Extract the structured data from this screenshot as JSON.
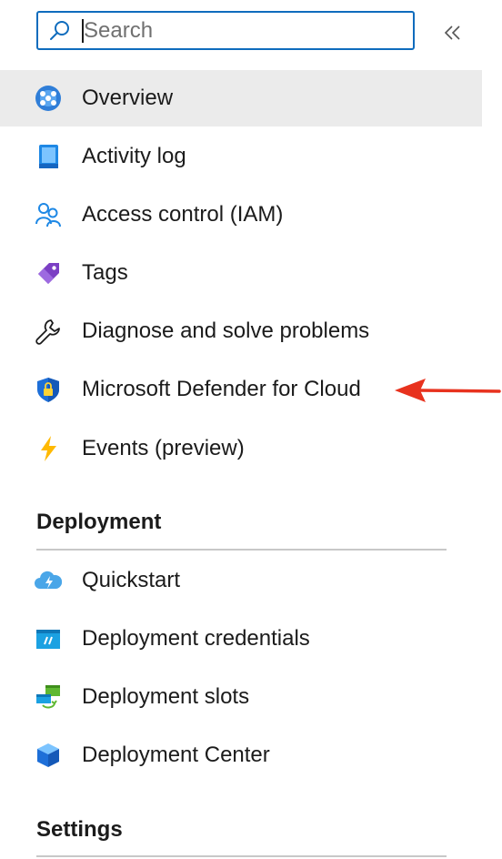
{
  "search": {
    "placeholder": "Search",
    "icon": "search-icon"
  },
  "collapse_icon": "double-chevron-left-icon",
  "nav_items": [
    {
      "label": "Overview",
      "icon": "overview-icon",
      "selected": true
    },
    {
      "label": "Activity log",
      "icon": "activity-log-icon"
    },
    {
      "label": "Access control (IAM)",
      "icon": "people-icon"
    },
    {
      "label": "Tags",
      "icon": "tag-icon"
    },
    {
      "label": "Diagnose and solve problems",
      "icon": "wrench-icon"
    },
    {
      "label": "Microsoft Defender for Cloud",
      "icon": "shield-lock-icon"
    },
    {
      "label": "Events (preview)",
      "icon": "lightning-icon"
    }
  ],
  "sections": [
    {
      "title": "Deployment",
      "items": [
        {
          "label": "Quickstart",
          "icon": "cloud-lightning-icon"
        },
        {
          "label": "Deployment credentials",
          "icon": "credentials-icon"
        },
        {
          "label": "Deployment slots",
          "icon": "deployment-slots-icon"
        },
        {
          "label": "Deployment Center",
          "icon": "cube-icon"
        }
      ]
    },
    {
      "title": "Settings",
      "items": []
    }
  ],
  "colors": {
    "accent": "#0f6cbd",
    "selected_background": "#ebebeb",
    "annotation_arrow": "#e8321e"
  }
}
